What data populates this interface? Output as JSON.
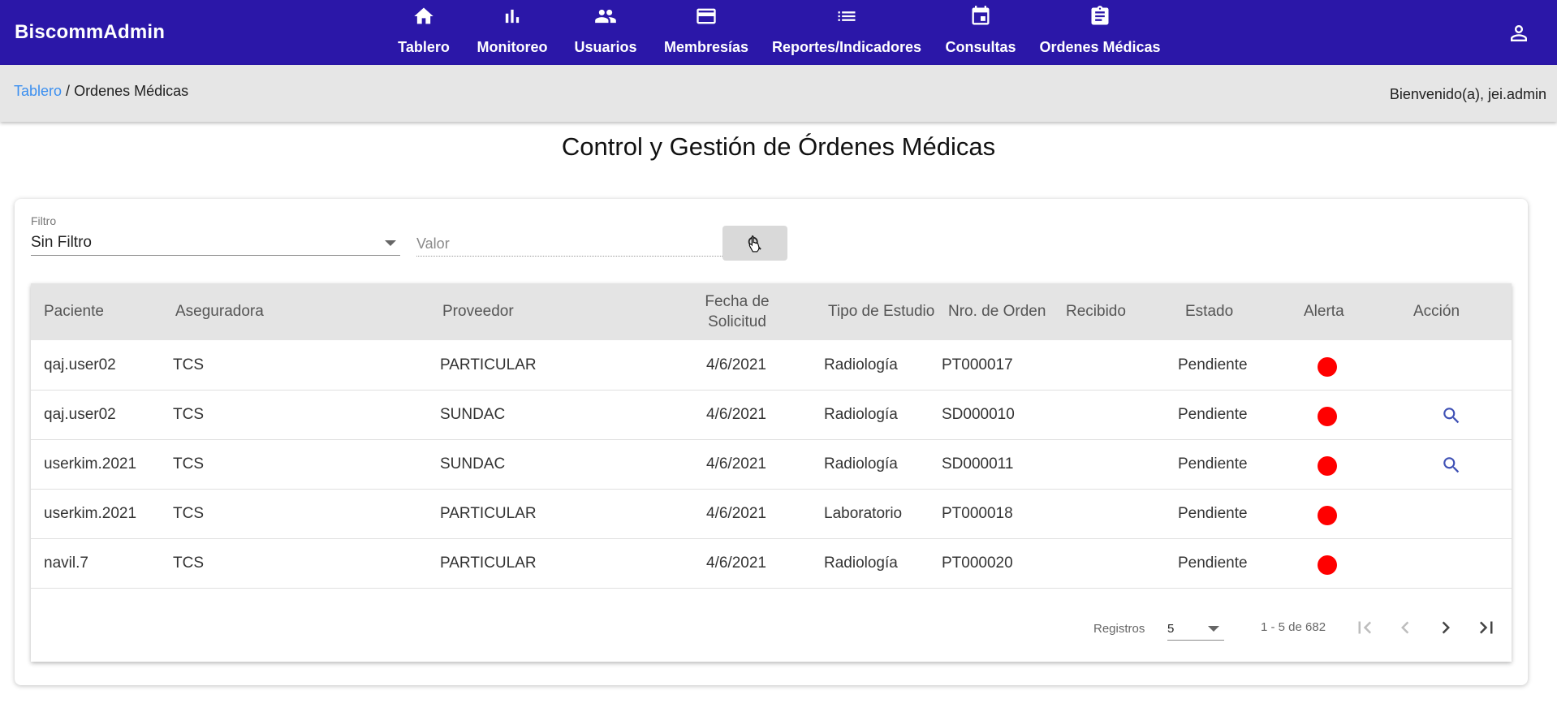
{
  "app": {
    "brand": "BiscommAdmin"
  },
  "nav": [
    {
      "label": "Tablero",
      "icon": "home-icon"
    },
    {
      "label": "Monitoreo",
      "icon": "bar-chart-icon"
    },
    {
      "label": "Usuarios",
      "icon": "people-icon"
    },
    {
      "label": "Membresías",
      "icon": "credit-card-icon"
    },
    {
      "label": "Reportes/Indicadores",
      "icon": "list-icon"
    },
    {
      "label": "Consultas",
      "icon": "calendar-icon"
    },
    {
      "label": "Ordenes Médicas",
      "icon": "assignment-icon"
    }
  ],
  "header": {
    "account_icon": "account-icon"
  },
  "breadcrumb": {
    "root": "Tablero",
    "separator": " / ",
    "current": "Ordenes Médicas"
  },
  "welcome": "Bienvenido(a), jei.admin",
  "page": {
    "title": "Control y Gestión de Órdenes Médicas"
  },
  "filter": {
    "label": "Filtro",
    "selected": "Sin Filtro",
    "value_placeholder": "Valor"
  },
  "table": {
    "headers": [
      "Paciente",
      "Aseguradora",
      "Proveedor",
      "Fecha de Solicitud",
      "Tipo de Estudio",
      "Nro. de Orden",
      "Recibido",
      "Estado",
      "Alerta",
      "Acción"
    ],
    "rows": [
      {
        "paciente": "qaj.user02",
        "aseguradora": "TCS",
        "proveedor": "PARTICULAR",
        "fecha": "4/6/2021",
        "tipo": "Radiología",
        "orden": "PT000017",
        "recibido": "",
        "estado": "Pendiente",
        "alerta": "red",
        "accion": false
      },
      {
        "paciente": "qaj.user02",
        "aseguradora": "TCS",
        "proveedor": "SUNDAC",
        "fecha": "4/6/2021",
        "tipo": "Radiología",
        "orden": "SD000010",
        "recibido": "",
        "estado": "Pendiente",
        "alerta": "red",
        "accion": true
      },
      {
        "paciente": "userkim.2021",
        "aseguradora": "TCS",
        "proveedor": "SUNDAC",
        "fecha": "4/6/2021",
        "tipo": "Radiología",
        "orden": "SD000011",
        "recibido": "",
        "estado": "Pendiente",
        "alerta": "red",
        "accion": true
      },
      {
        "paciente": "userkim.2021",
        "aseguradora": "TCS",
        "proveedor": "PARTICULAR",
        "fecha": "4/6/2021",
        "tipo": "Laboratorio",
        "orden": "PT000018",
        "recibido": "",
        "estado": "Pendiente",
        "alerta": "red",
        "accion": false
      },
      {
        "paciente": "navil.7",
        "aseguradora": "TCS",
        "proveedor": "PARTICULAR",
        "fecha": "4/6/2021",
        "tipo": "Radiología",
        "orden": "PT000020",
        "recibido": "",
        "estado": "Pendiente",
        "alerta": "red",
        "accion": false
      }
    ]
  },
  "pagination": {
    "label": "Registros",
    "page_size": "5",
    "range": "1 - 5 de 682"
  },
  "colors": {
    "primary": "#2b17a8",
    "link": "#3b8ff0",
    "alert": "#ff0000",
    "action_icon": "#3f51b5"
  }
}
